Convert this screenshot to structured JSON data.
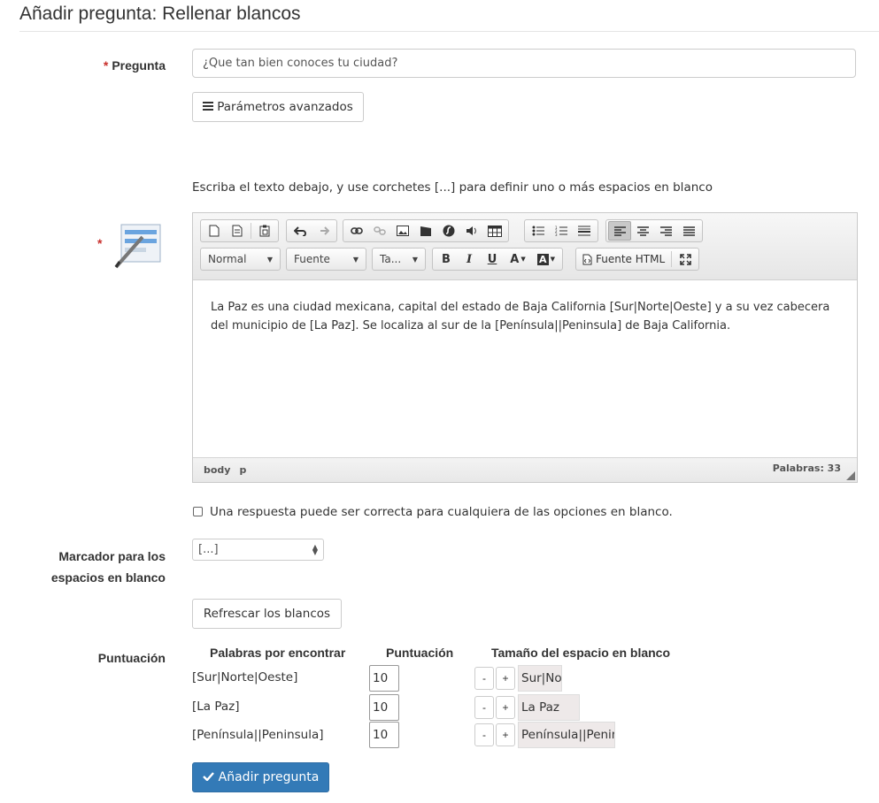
{
  "page": {
    "title": "Añadir pregunta: Rellenar blancos"
  },
  "question": {
    "label": "Pregunta",
    "required_mark": "*",
    "value": "¿Que tan bien conoces tu ciudad?"
  },
  "advanced_button": {
    "label": "Parámetros avanzados",
    "icon": "menu-icon"
  },
  "instructions": "Escriba el texto debajo, y use corchetes [...] para definir uno o más espacios en blanco",
  "editor": {
    "required_mark": "*",
    "toolbar": {
      "format_combo": "Normal",
      "font_combo": "Fuente",
      "size_combo": "Ta...",
      "source_label": "Fuente HTML"
    },
    "content": "La Paz es una ciudad mexicana, capital del estado de Baja California [Sur|Norte|Oeste] y a su vez cabecera del municipio de [La Paz]. Se localiza al sur de la [Península||Peninsula] de Baja California.",
    "path": [
      "body",
      "p"
    ],
    "word_count": "Palabras: 33"
  },
  "multiple_answers": {
    "checked": false,
    "label": "Una respuesta puede ser correcta para cualquiera de las opciones en blanco."
  },
  "marker": {
    "label_line1": "Marcador para los",
    "label_line2": "espacios en blanco",
    "selected": "[...]"
  },
  "refresh_button": {
    "label": "Refrescar los blancos"
  },
  "scoring": {
    "label": "Puntuación",
    "headers": {
      "words": "Palabras por encontrar",
      "score": "Puntuación",
      "size": "Tamaño del espacio en blanco"
    },
    "rows": [
      {
        "word": "[Sur|Norte|Oeste]",
        "score": "10",
        "minus": "-",
        "plus": "+",
        "preview": "Sur|Norte|Oeste"
      },
      {
        "word": "[La Paz]",
        "score": "10",
        "minus": "-",
        "plus": "+",
        "preview": "La Paz"
      },
      {
        "word": "[Península||Peninsula]",
        "score": "10",
        "minus": "-",
        "plus": "+",
        "preview": "Península||Peninsula"
      }
    ]
  },
  "submit_button": {
    "label": "Añadir pregunta",
    "icon": "check-icon"
  },
  "colors": {
    "primary": "#337ab7",
    "required": "#c9302c"
  }
}
